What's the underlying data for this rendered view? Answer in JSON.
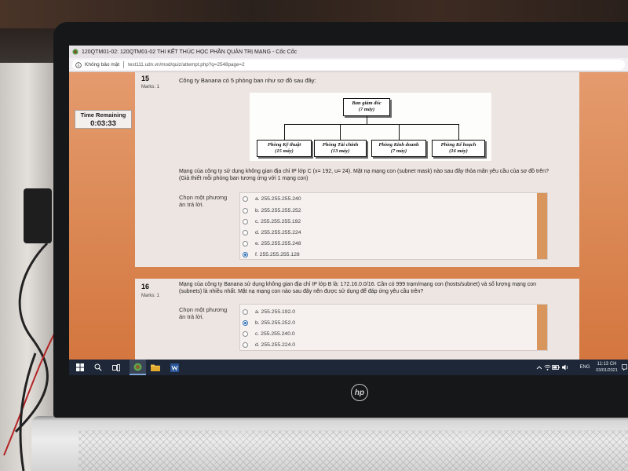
{
  "browser": {
    "app_icon": "coccoc-icon",
    "window_title": "120QTM01-02: 120QTM01-02 THI KẾT THÚC HỌC PHẦN QUẢN TRỊ MẠNG - Cốc Cốc",
    "security_icon": "info-icon",
    "security_label": "Không bảo mật",
    "url": "test111.udn.vn/mod/quiz/attempt.php?q=2548page=2"
  },
  "timer": {
    "label": "Time Remaining",
    "value": "0:03:33"
  },
  "questions": [
    {
      "number": "15",
      "marks": "Marks: 1",
      "intro": "Công ty Banana có 5 phòng ban như sơ đồ sau đây:",
      "diagram": {
        "root": {
          "name": "Ban giám đốc",
          "machines": "(7 máy)"
        },
        "departments": [
          {
            "name": "Phòng Kỹ thuật",
            "machines": "(15 máy)"
          },
          {
            "name": "Phòng Tài chính",
            "machines": "(13 máy)"
          },
          {
            "name": "Phòng Kinh doanh",
            "machines": "(7 máy)"
          },
          {
            "name": "Phòng Kế hoạch",
            "machines": "(16 máy)"
          }
        ]
      },
      "text": "Mạng của công ty sử dụng không gian địa chỉ IP lớp C (x= 192, u= 24). Mặt nạ mạng con (subnet mask) nào sau đây thỏa mãn yêu cầu của sơ đồ trên? (Giả thiết mỗi phòng ban tương ứng với 1 mạng con)",
      "prompt": "Chọn một phương án trả lời.",
      "options": [
        {
          "label": "a. 255.255.255.240",
          "selected": false
        },
        {
          "label": "b. 255.255.255.252",
          "selected": false
        },
        {
          "label": "c. 255.255.255.192",
          "selected": false
        },
        {
          "label": "d. 255.255.255.224",
          "selected": false
        },
        {
          "label": "e. 255.255.255.248",
          "selected": false
        },
        {
          "label": "f. 255.255.255.128",
          "selected": true
        }
      ]
    },
    {
      "number": "16",
      "marks": "Marks: 1",
      "text": "Mạng của công ty Banana sử dụng không gian địa chỉ IP lớp B là: 172.16.0.0/16. Cần có 999 trạm/mạng con (hosts/subnet) và số lượng mạng con (subnets) là nhiều nhất. Mặt nạ mạng con nào sau đây nên được sử dụng để đáp ứng yêu cầu trên?",
      "prompt": "Chọn một phương án trả lời.",
      "options": [
        {
          "label": "a. 255.255.192.0",
          "selected": false
        },
        {
          "label": "b. 255.255.252.0",
          "selected": true
        },
        {
          "label": "c. 255.255.240.0",
          "selected": false
        },
        {
          "label": "d. 255.255.224.0",
          "selected": false
        }
      ]
    }
  ],
  "taskbar": {
    "pinned_icons": [
      "windows-start-icon",
      "search-icon",
      "task-view-icon",
      "coccoc-browser-icon",
      "file-explorer-icon",
      "word-icon"
    ],
    "active_app": "coccoc-browser-icon",
    "tray_icons": [
      "chevron-up-icon",
      "network-icon",
      "battery-icon",
      "volume-icon"
    ],
    "language": "ENG",
    "time": "11:13 CH",
    "date": "03/01/2021",
    "notification_icon": "notification-icon"
  },
  "device": {
    "logo": "hp"
  },
  "theme": {
    "page_bg_top": "#e59b6e",
    "page_bg_bottom": "#d4763f",
    "card_bg": "#ede5e1",
    "radio_checked": "#2f6fb5",
    "taskbar_bg": "#1d2738"
  }
}
